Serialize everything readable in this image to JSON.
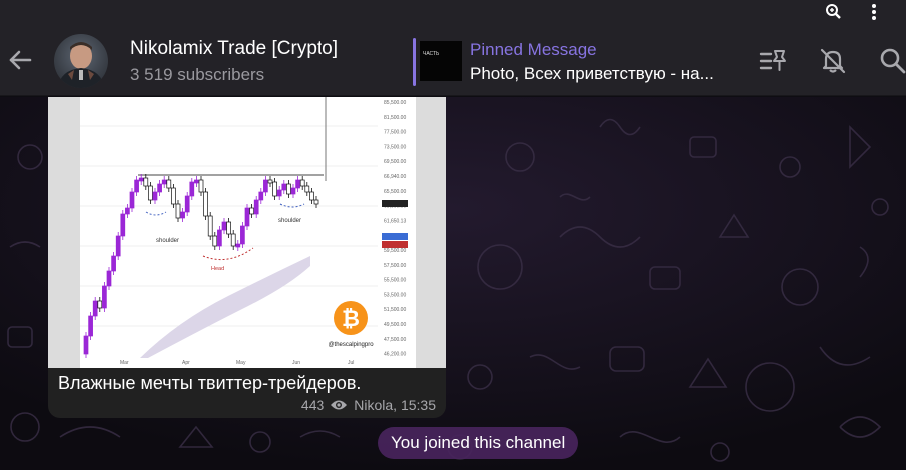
{
  "header": {
    "title": "Nikolamix Trade [Crypto]",
    "subscribers": "3 519 subscribers"
  },
  "pinned": {
    "label": "Pinned Message",
    "text": "Photo, Всех приветствую - на...",
    "thumb_text": "ЧАСТЬ"
  },
  "message": {
    "caption": "Влажные мечты твиттер-трейдеров.",
    "views": "443",
    "author_time": "Nikola, 15:35",
    "image": {
      "price_labels": [
        "85,500.00",
        "81,500.00",
        "77,500.00",
        "73,500.00",
        "69,500.00",
        "66,940.00",
        "65,500.00",
        "63,500.00",
        "61,650.13",
        "60,391.20",
        "59,500.00",
        "57,500.00",
        "55,500.00",
        "53,500.00",
        "51,500.00",
        "49,500.00",
        "47,500.00",
        "46,200.00"
      ],
      "months": [
        "Mar",
        "Apr",
        "May",
        "Jun",
        "Jul"
      ],
      "annotations": {
        "left_shoulder": "shoulder",
        "right_shoulder": "shoulder",
        "head": "Head"
      },
      "watermark": "@thescalpingpro",
      "btc_symbol": "₿"
    }
  },
  "service": {
    "joined": "You joined this channel"
  },
  "colors": {
    "accent": "#8774e1",
    "header_bg": "#232227",
    "bubble_bg": "#212121",
    "candle": "#9b27d6"
  }
}
